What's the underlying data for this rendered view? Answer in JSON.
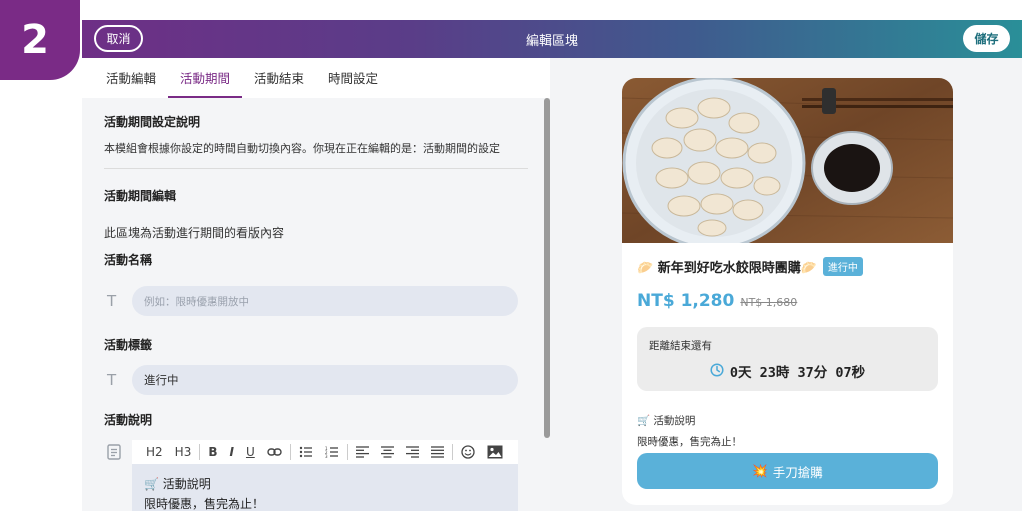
{
  "step_badge": "2",
  "topbar": {
    "title": "編輯區塊",
    "cancel_label": "取消",
    "save_label": "儲存"
  },
  "tabs": [
    {
      "label": "活動編輯",
      "active": false
    },
    {
      "label": "活動期間",
      "active": true
    },
    {
      "label": "活動結束",
      "active": false
    },
    {
      "label": "時間設定",
      "active": false
    }
  ],
  "left": {
    "desc_heading": "活動期間設定說明",
    "desc_text": "本模組會根據你設定的時間自動切換內容。你現在正在編輯的是：活動期間的設定",
    "edit_heading": "活動期間編輯",
    "area_text": "此區塊為活動進行期間的看版內容",
    "name_label": "活動名稱",
    "name_placeholder": "例如：限時優惠開放中",
    "tag_label": "活動標籤",
    "tag_value": "進行中",
    "desc_label": "活動說明",
    "editor_toolbar": [
      "H2",
      "H3",
      "B",
      "I",
      "U",
      "link",
      "bullet-list",
      "numbered-list",
      "align-left",
      "align-center",
      "align-right",
      "justify",
      "emoji",
      "image"
    ],
    "editor_line1": "🛒 活動說明",
    "editor_line2": "限時優惠，售完為止！"
  },
  "preview": {
    "title": "🥟 新年到好吃水餃限時團購🥟",
    "status": "進行中",
    "price": "NT$ 1,280",
    "original_price": "NT$ 1,680",
    "countdown_label": "距離結束還有",
    "countdown": "0天 23時 37分 07秒",
    "activity_title": "🛒 活動說明",
    "activity_desc": "限時優惠，售完為止！",
    "buy_label": "手刀搶購",
    "buy_emoji": "💥"
  },
  "colors": {
    "accent": "#7a2b86",
    "preview_blue": "#5ab1d9"
  }
}
